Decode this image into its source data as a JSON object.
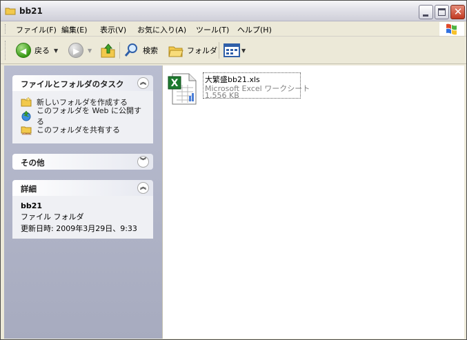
{
  "window": {
    "title": "bb21",
    "buttons": {
      "minimize": "",
      "maximize": "",
      "close": "✕"
    }
  },
  "menubar": {
    "items": [
      "ファイル(F)",
      "編集(E)",
      "表示(V)",
      "お気に入り(A)",
      "ツール(T)",
      "ヘルプ(H)"
    ]
  },
  "toolbar": {
    "back_label": "戻る",
    "search_label": "検索",
    "folders_label": "フォルダ"
  },
  "taskpane": {
    "tasks": {
      "title": "ファイルとフォルダのタスク",
      "items": [
        {
          "label": "新しいフォルダを作成する",
          "icon": "new-folder-icon"
        },
        {
          "label": "このフォルダを Web に公開する",
          "icon": "publish-web-icon"
        },
        {
          "label": "このフォルダを共有する",
          "icon": "share-folder-icon"
        }
      ]
    },
    "other": {
      "title": "その他"
    },
    "details": {
      "title": "詳細",
      "name": "bb21",
      "type": "ファイル フォルダ",
      "modified": "更新日時: 2009年3月29日、9:33"
    }
  },
  "files": [
    {
      "name": "大繁盛bb21.xls",
      "type": "Microsoft Excel ワークシート",
      "size": "1,556 KB",
      "icon": "excel-file-icon"
    }
  ],
  "colors": {
    "excel_green": "#1d7a2f",
    "folder_yellow": "#f2c94c"
  }
}
